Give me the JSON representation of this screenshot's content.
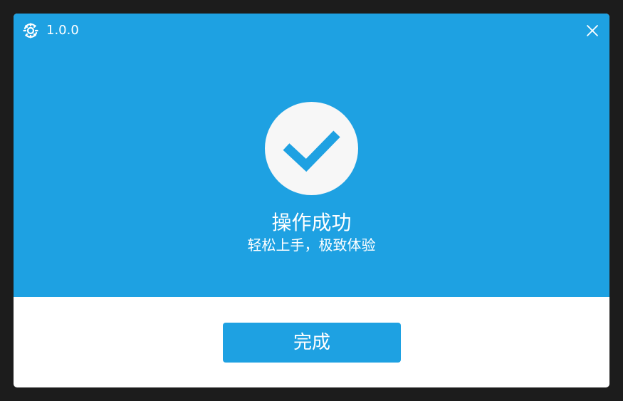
{
  "window": {
    "version": "1.0.0",
    "logo_icon": "gear-sync-icon",
    "close_icon": "close-icon"
  },
  "main": {
    "status_icon": "checkmark-icon",
    "title": "操作成功",
    "subtitle": "轻松上手，极致体验"
  },
  "footer": {
    "done_label": "完成"
  },
  "colors": {
    "accent": "#1ea1e2",
    "circle": "#f7f7f7",
    "background": "#1c1c1c"
  }
}
